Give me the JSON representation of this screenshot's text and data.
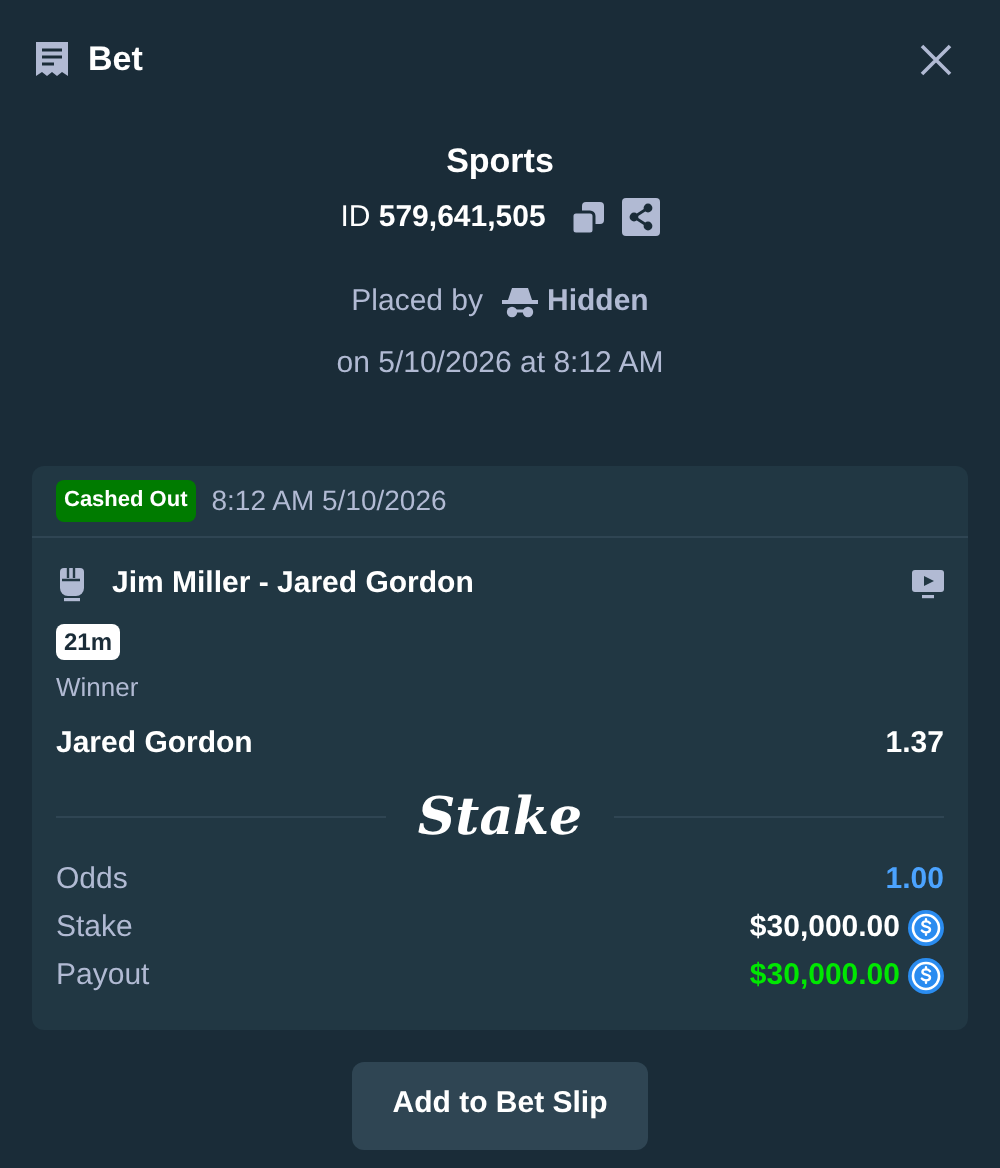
{
  "dialog": {
    "title": "Bet"
  },
  "header": {
    "category": "Sports",
    "id_label": "ID",
    "id_value": "579,641,505",
    "placed_by_label": "Placed by",
    "placed_by_user": "Hidden",
    "placed_on": "on 5/10/2026 at 8:12 AM"
  },
  "bet": {
    "status": {
      "label": "Cashed Out",
      "color": "#007b00"
    },
    "time": "8:12 AM 5/10/2026",
    "event": "Jim Miller - Jared Gordon",
    "live_time": "21m",
    "market": "Winner",
    "selection": "Jared Gordon",
    "selection_odds": "1.37",
    "brand": "Stake",
    "summary": [
      {
        "label": "Odds",
        "value": "1.00",
        "kind": "odds",
        "color": "#4ba3ff"
      },
      {
        "label": "Stake",
        "value": "$30,000.00",
        "kind": "amount",
        "color": "#ffffff"
      },
      {
        "label": "Payout",
        "value": "$30,000.00",
        "kind": "amount",
        "color": "#00e701"
      }
    ]
  },
  "buttons": [
    {
      "label": "Add to Bet Slip"
    }
  ]
}
